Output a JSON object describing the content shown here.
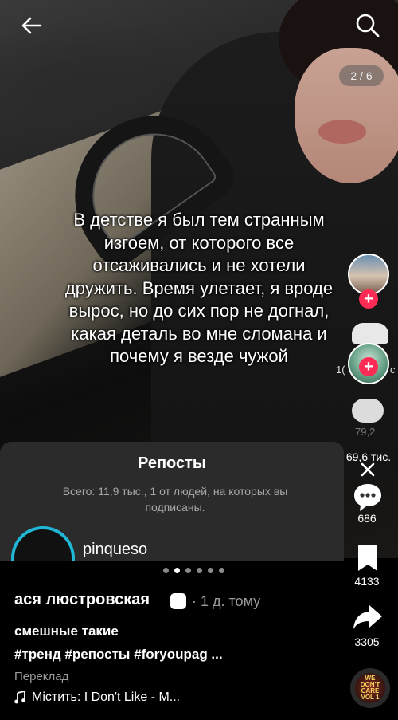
{
  "header": {
    "slide_counter": "2 / 6"
  },
  "caption": "В детстве я был тем странным изгоем, от которого все отсаживались и не хотели дружить. Время улетает, я вроде вырос, но до сих пор не догнал, какая деталь во мне сломана и почему я везде чужой",
  "rail": {
    "partial_left": "1(",
    "partial_right": "c",
    "partial_count": "79,2",
    "likes": "69,6 тис.",
    "comments": "686",
    "saves": "4133",
    "shares": "3305",
    "album_text": "WE DON'T CARE VOL 1"
  },
  "reposts_sheet": {
    "title": "Репосты",
    "subtitle": "Всего: 11,9 тыс., 1 от людей, на которых вы подписаны.",
    "user": "pinqueso"
  },
  "carousel": {
    "total": 6,
    "active": 1
  },
  "post": {
    "author": "ася люстровская",
    "time": "· 1 д. тому",
    "description": "смешные такие",
    "hashtags": "#тренд #репосты #foryoupag ...",
    "translate_label": "Переклад",
    "music_label": "Містить: I Don't Like - M..."
  },
  "colors": {
    "follow_accent": "#fe2c55",
    "story_ring": "#1fb8d6"
  }
}
